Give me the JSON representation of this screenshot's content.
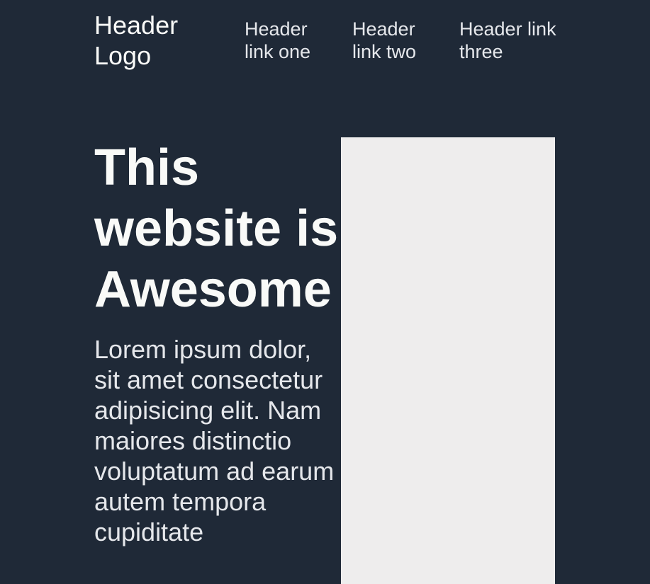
{
  "header": {
    "logo": "Header Logo",
    "links": [
      "Header link one",
      "Header link two",
      "Header link three"
    ]
  },
  "hero": {
    "title": "This website is Awesome",
    "text": "Lorem ipsum dolor, sit amet consectetur adipisicing elit. Nam maiores distinctio voluptatum ad earum autem tempora cupiditate"
  },
  "colors": {
    "background": "#1f2937",
    "heading": "#f9faf8",
    "text": "#e5e7eb",
    "placeholder": "#eeeded"
  }
}
